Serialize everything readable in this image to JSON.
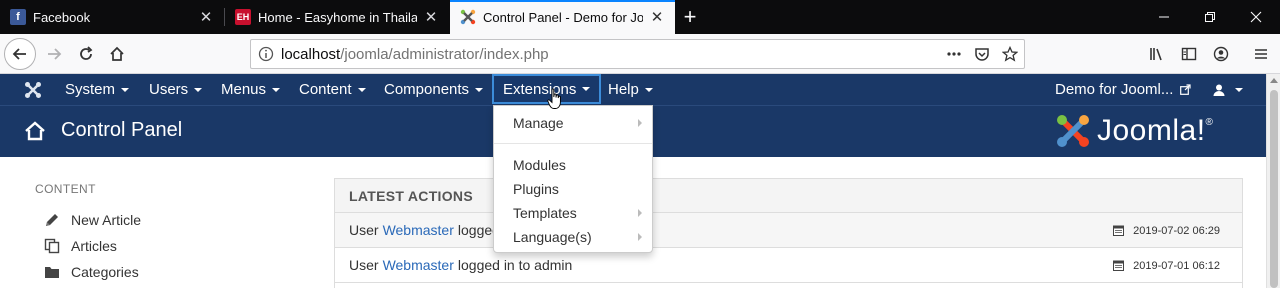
{
  "browser": {
    "tabs": [
      {
        "title": "Facebook",
        "favicon": "facebook-icon",
        "active": false
      },
      {
        "title": "Home - Easyhome in Thailand",
        "favicon": "easyhome-icon",
        "active": false
      },
      {
        "title": "Control Panel - Demo for Joomla",
        "favicon": "joomla-icon",
        "active": true
      }
    ],
    "url_host": "localhost",
    "url_path": "/joomla/administrator/index.php"
  },
  "topmenu": {
    "items": [
      {
        "label": "System"
      },
      {
        "label": "Users"
      },
      {
        "label": "Menus"
      },
      {
        "label": "Content"
      },
      {
        "label": "Components"
      },
      {
        "label": "Extensions",
        "open": true
      },
      {
        "label": "Help"
      }
    ],
    "site_link": "Demo for Jooml..."
  },
  "header": {
    "title": "Control Panel",
    "brand": "Joomla!",
    "brand_mark": "®"
  },
  "sidebar": {
    "heading": "CONTENT",
    "items": [
      {
        "label": "New Article",
        "icon": "pencil-icon"
      },
      {
        "label": "Articles",
        "icon": "copy-icon"
      },
      {
        "label": "Categories",
        "icon": "folder-icon"
      }
    ]
  },
  "latest_actions": {
    "heading": "LATEST ACTIONS",
    "rows": [
      {
        "prefix": "User",
        "user": "Webmaster",
        "action": "logged",
        "datetime": "2019-07-02 06:29"
      },
      {
        "prefix": "User",
        "user": "Webmaster",
        "action": "logged in to admin",
        "datetime": "2019-07-01 06:12"
      }
    ]
  },
  "extensions_menu": {
    "items": [
      {
        "label": "Manage",
        "submenu": true
      },
      {
        "label": "Modules",
        "submenu": false
      },
      {
        "label": "Plugins",
        "submenu": false
      },
      {
        "label": "Templates",
        "submenu": true
      },
      {
        "label": "Language(s)",
        "submenu": true
      }
    ]
  },
  "colors": {
    "joomla_nav": "#1a3867",
    "link_blue": "#2a69b8",
    "active_tab_accent": "#0a84ff"
  }
}
